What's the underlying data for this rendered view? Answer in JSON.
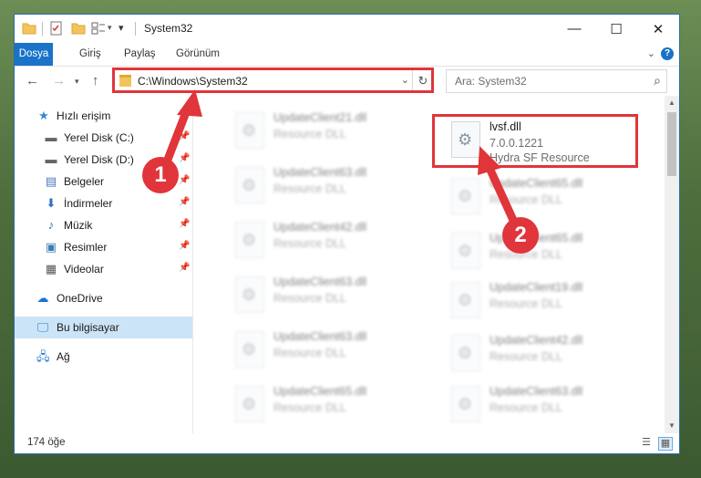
{
  "window": {
    "title": "System32"
  },
  "ribbon": {
    "tabs": [
      "Dosya",
      "Giriş",
      "Paylaş",
      "Görünüm"
    ]
  },
  "address": {
    "path": "C:\\Windows\\System32"
  },
  "search": {
    "placeholder": "Ara: System32"
  },
  "nav": {
    "items": [
      {
        "label": "Hızlı erişim",
        "icon": "star-icon",
        "pinned": false
      },
      {
        "label": "Yerel Disk (C:)",
        "icon": "drive-icon",
        "pinned": true
      },
      {
        "label": "Yerel Disk (D:)",
        "icon": "drive-icon",
        "pinned": true
      },
      {
        "label": "Belgeler",
        "icon": "documents-icon",
        "pinned": true
      },
      {
        "label": "İndirmeler",
        "icon": "download-icon",
        "pinned": true
      },
      {
        "label": "Müzik",
        "icon": "music-icon",
        "pinned": true
      },
      {
        "label": "Resimler",
        "icon": "pictures-icon",
        "pinned": true
      },
      {
        "label": "Videolar",
        "icon": "video-icon",
        "pinned": true
      },
      {
        "label": "OneDrive",
        "icon": "cloud-icon",
        "pinned": false
      },
      {
        "label": "Bu bilgisayar",
        "icon": "computer-icon",
        "pinned": false
      },
      {
        "label": "Ağ",
        "icon": "network-icon",
        "pinned": false
      }
    ]
  },
  "files": {
    "left": [
      {
        "name": "UpdateClient21.dll",
        "type": "Resource DLL"
      },
      {
        "name": "UpdateClient63.dll",
        "type": "Resource DLL"
      },
      {
        "name": "UpdateClient42.dll",
        "type": "Resource DLL"
      },
      {
        "name": "UpdateClient63.dll",
        "type": "Resource DLL"
      },
      {
        "name": "UpdateClient63.dll",
        "type": "Resource DLL"
      },
      {
        "name": "UpdateClient65.dll",
        "type": "Resource DLL"
      }
    ],
    "right": [
      {
        "name": "lvsf.dll",
        "version": "7.0.0.1221",
        "type": "Hydra SF Resource"
      },
      {
        "name": "UpdateClient65.dll",
        "type": "Resource DLL"
      },
      {
        "name": "UpdateClient65.dll",
        "type": "Resource DLL"
      },
      {
        "name": "UpdateClient19.dll",
        "type": "Resource DLL"
      },
      {
        "name": "UpdateClient42.dll",
        "type": "Resource DLL"
      },
      {
        "name": "UpdateClient63.dll",
        "type": "Resource DLL"
      }
    ]
  },
  "status": {
    "count": "174 öğe"
  },
  "annotations": {
    "step1": "1",
    "step2": "2"
  },
  "colors": {
    "accent": "#1a73c7",
    "highlight": "#e0353a"
  }
}
